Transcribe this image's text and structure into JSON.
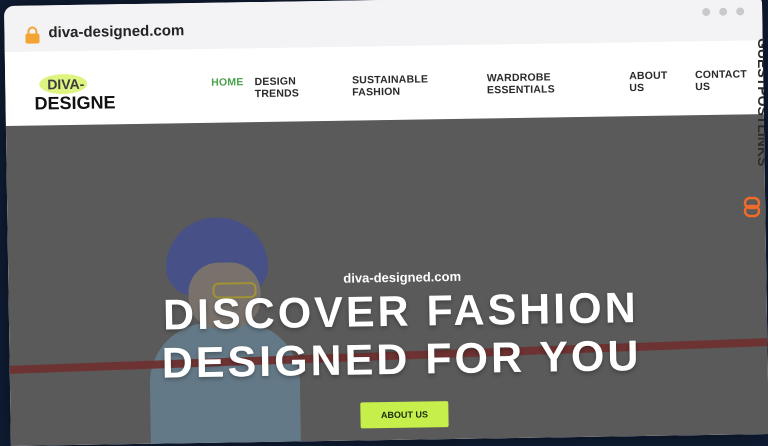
{
  "browser": {
    "url": "diva-designed.com"
  },
  "site": {
    "logo_top": "DIVA-",
    "logo_bottom": "DESIGNED",
    "nav": [
      {
        "label": "HOME",
        "active": true
      },
      {
        "label": "DESIGN TRENDS",
        "active": false
      },
      {
        "label": "SUSTAINABLE FASHION",
        "active": false
      },
      {
        "label": "WARDROBE ESSENTIALS",
        "active": false
      },
      {
        "label": "ABOUT US",
        "active": false
      },
      {
        "label": "CONTACT US",
        "active": false
      }
    ]
  },
  "hero": {
    "site_name": "diva-designed.com",
    "title_line1": "DISCOVER FASHION",
    "title_line2": "DESIGNED FOR YOU",
    "button_label": "ABOUT US"
  },
  "watermark": {
    "text": "GUESTPOSTLINKS"
  },
  "colors": {
    "nav_active": "#4aa24a",
    "button_bg": "#c6ef4c",
    "watermark_accent": "#f06a2a"
  }
}
